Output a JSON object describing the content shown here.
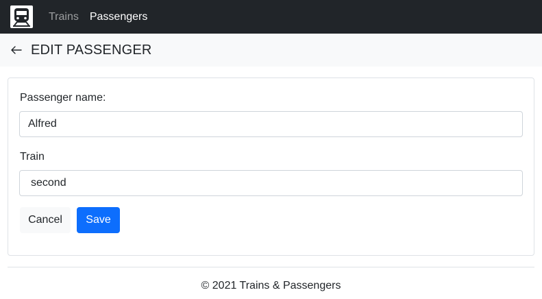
{
  "navbar": {
    "brand_icon": "train-icon",
    "links": [
      {
        "label": "Trains",
        "active": false
      },
      {
        "label": "Passengers",
        "active": true
      }
    ]
  },
  "header": {
    "back_icon": "arrow-left-icon",
    "title": "EDIT PASSENGER"
  },
  "form": {
    "name_label": "Passenger name:",
    "name_value": "Alfred",
    "train_label": "Train",
    "train_selected": "second",
    "cancel_label": "Cancel",
    "save_label": "Save"
  },
  "footer": {
    "text": "© 2021 Trains & Passengers"
  },
  "colors": {
    "navbar_bg": "#212529",
    "header_bg": "#f8f9fa",
    "primary": "#0d6efd",
    "border": "#dee2e6"
  }
}
